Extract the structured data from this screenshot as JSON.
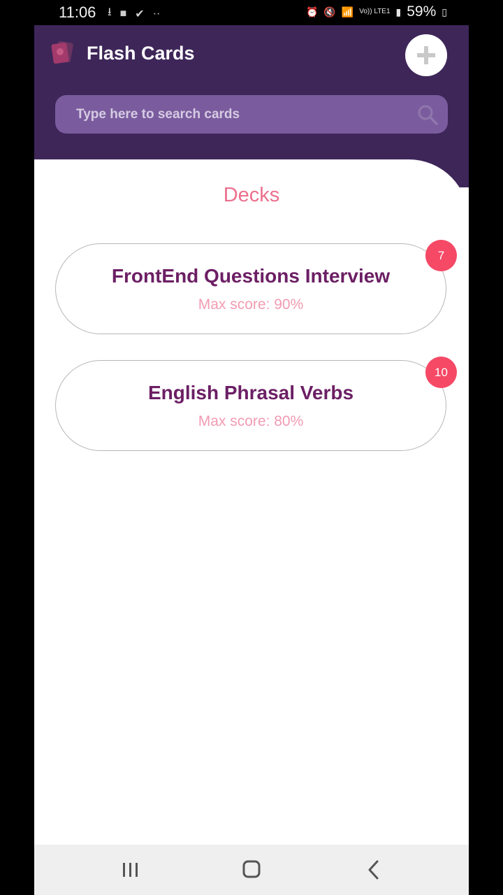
{
  "status_bar": {
    "time": "11:06",
    "battery": "59%",
    "network_label": "Vo)) LTE1"
  },
  "app": {
    "title": "Flash Cards",
    "search_placeholder": "Type here to search cards",
    "section_title": "Decks",
    "accent_color": "#3e2659"
  },
  "decks": [
    {
      "name": "FrontEnd Questions Interview",
      "score": "Max score: 90%",
      "count": "7"
    },
    {
      "name": "English Phrasal Verbs",
      "score": "Max score: 80%",
      "count": "10"
    }
  ]
}
